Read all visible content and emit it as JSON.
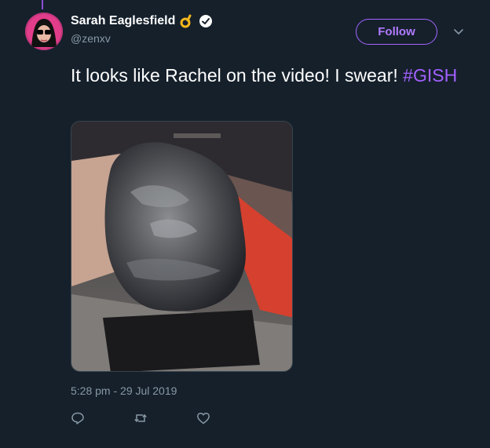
{
  "tweet": {
    "display_name": "Sarah Eaglesfield",
    "handle": "@zenxv",
    "follow_label": "Follow",
    "text_prefix": "It looks like Rachel on the video! I swear! ",
    "hashtag": "#GISH",
    "timestamp": "5:28 pm - 29 Jul 2019"
  },
  "icons": {
    "ok": "ok-hand-emoji",
    "verified": "verified-badge-icon",
    "more": "chevron-down-icon",
    "reply": "reply-icon",
    "retweet": "retweet-icon",
    "like": "heart-icon"
  },
  "colors": {
    "background": "#15202b",
    "accent": "#a260ff",
    "muted": "#8899a6"
  }
}
